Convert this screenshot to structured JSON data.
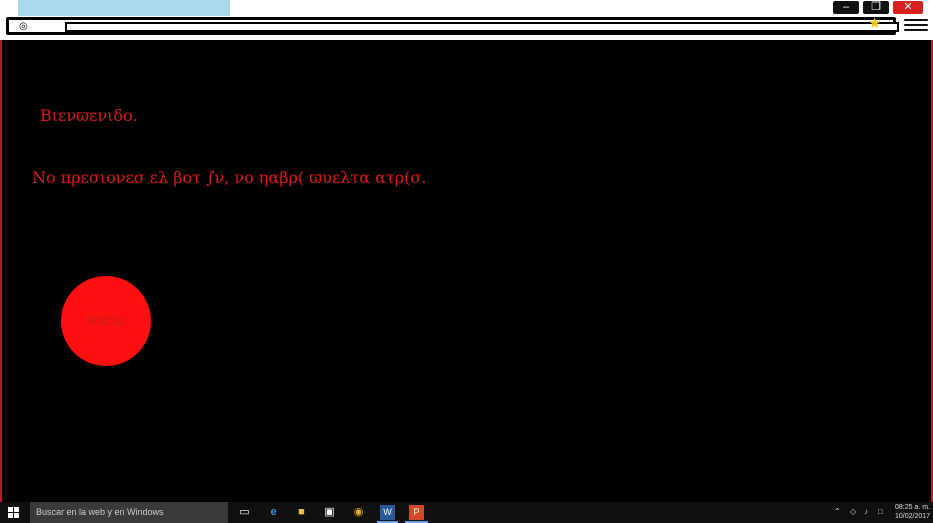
{
  "page": {
    "welcome": "Βιενϖενιδο.",
    "message": "Νο πρεσιονεσ ελ βοτ ∫ν,  νο ηαβρ( ϖυελτα ατρ(σ.",
    "start_button": "Inicio"
  },
  "taskbar": {
    "search_placeholder": "Buscar en la web y en Windows",
    "time": "08:25 a. m.",
    "date": "10/02/2017"
  },
  "colors": {
    "text_red": "#e01919",
    "button_red": "#ff0f0f",
    "background": "#000000"
  }
}
